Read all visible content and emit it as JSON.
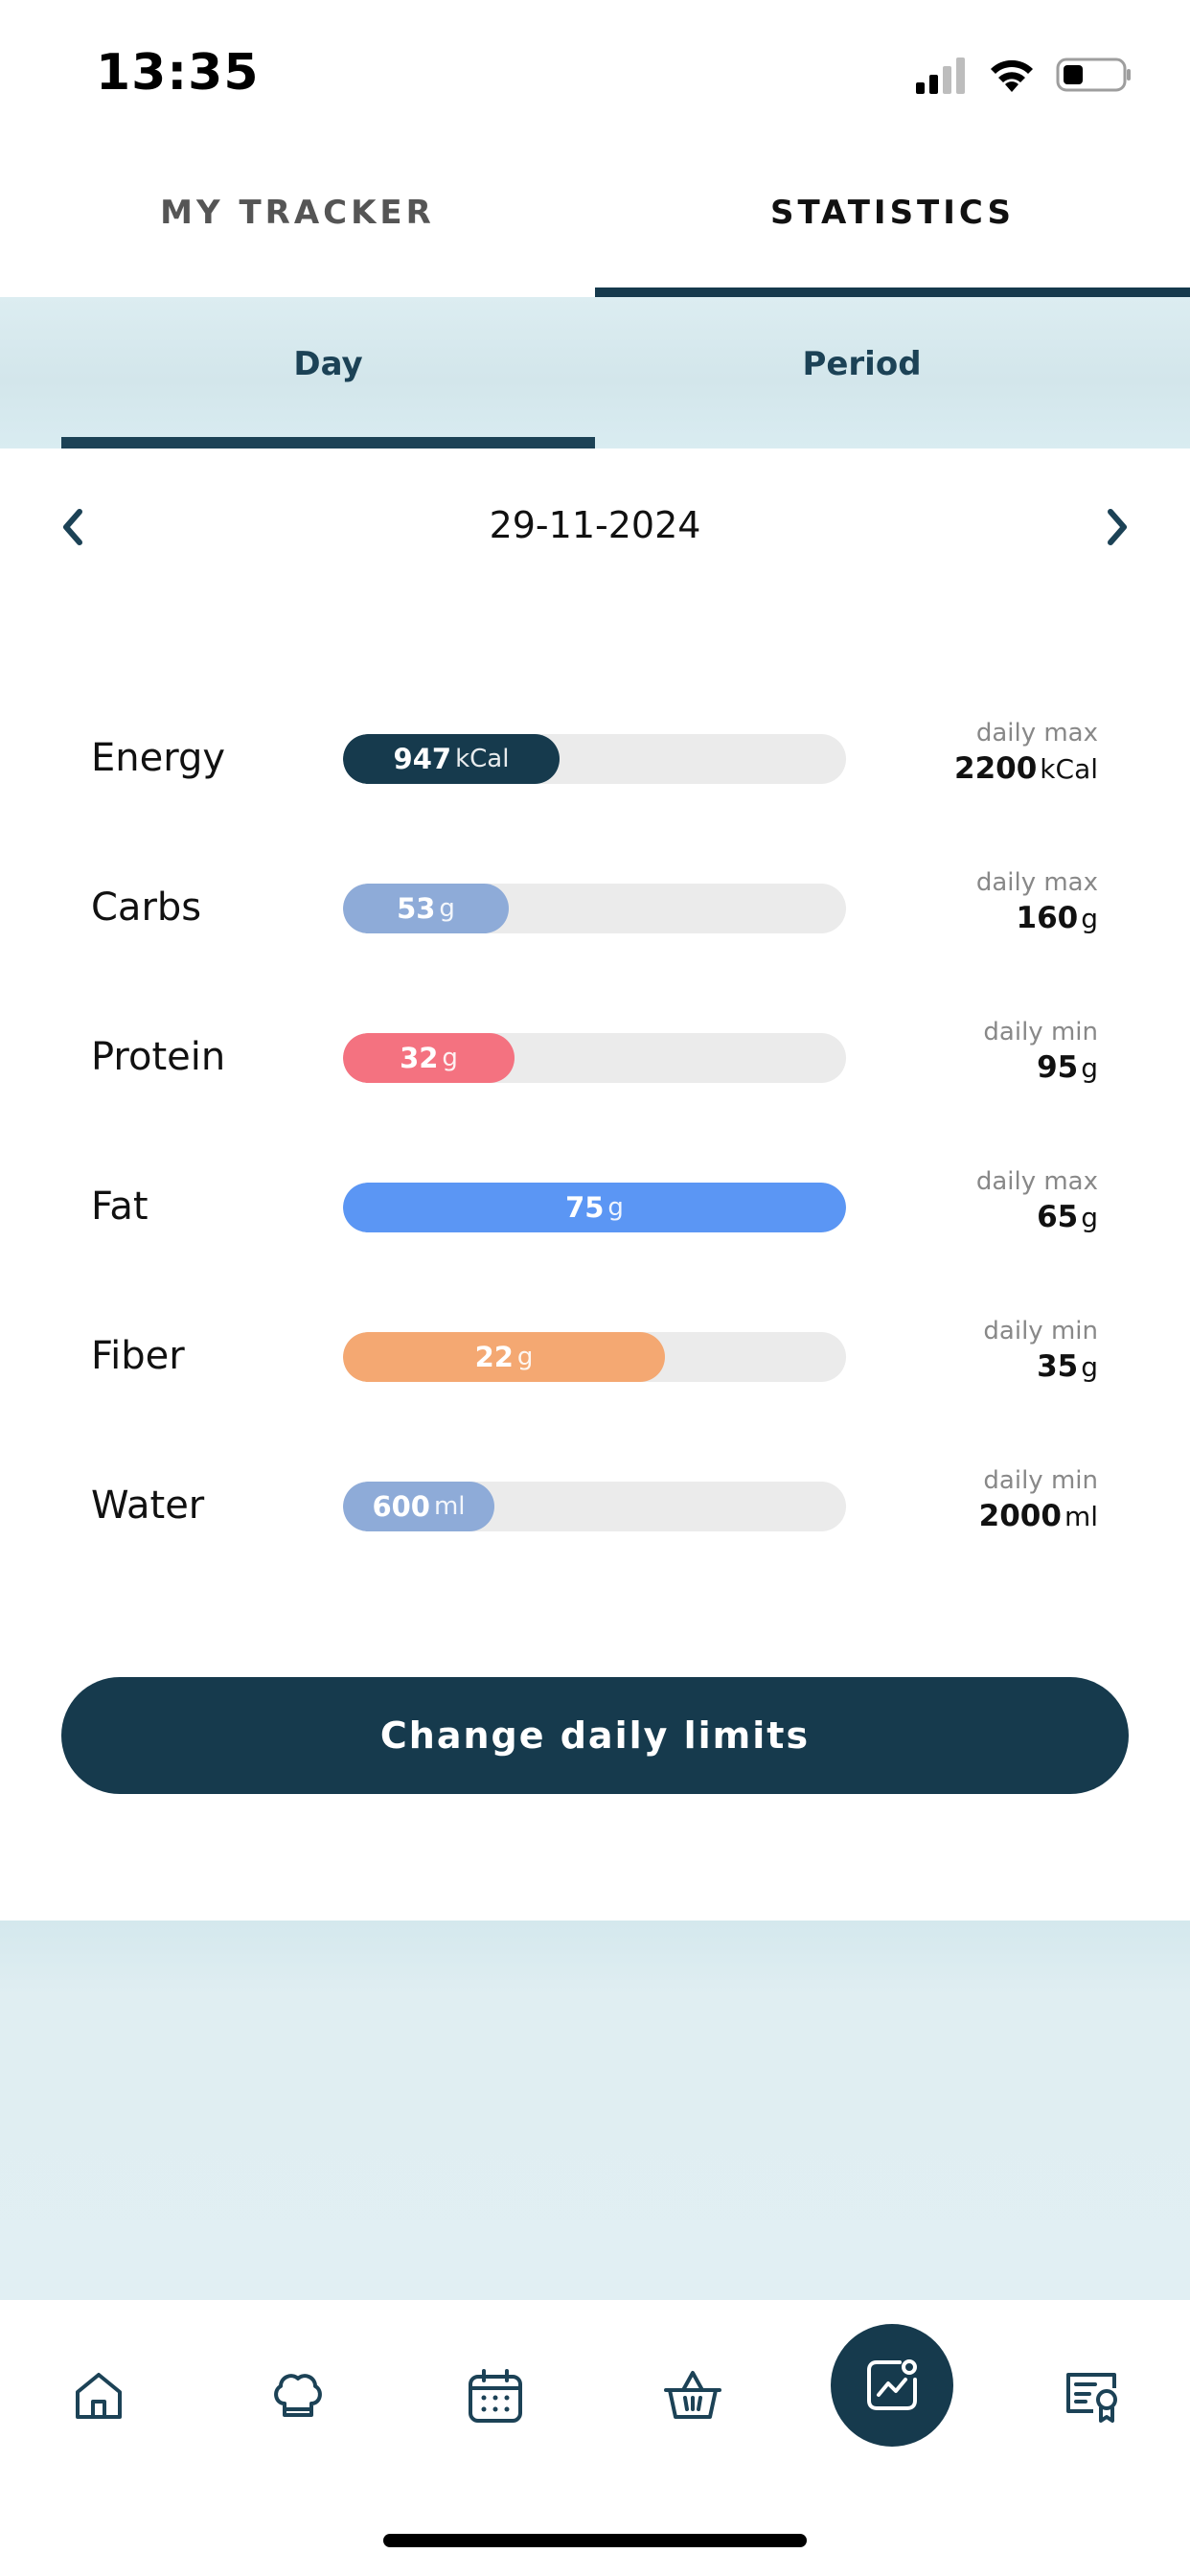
{
  "status_bar": {
    "time": "13:35"
  },
  "top_tabs": [
    {
      "label": "MY TRACKER",
      "active": false
    },
    {
      "label": "STATISTICS",
      "active": true
    }
  ],
  "sub_tabs": [
    {
      "label": "Day",
      "active": true
    },
    {
      "label": "Period",
      "active": false
    }
  ],
  "date": "29-11-2024",
  "nutrients": [
    {
      "name": "Energy",
      "value": "947",
      "unit": "kCal",
      "limit_label": "daily max",
      "limit_value": "2200",
      "limit_unit": "kCal",
      "fill_fraction": 0.43,
      "color": "#163a4d"
    },
    {
      "name": "Carbs",
      "value": "53",
      "unit": "g",
      "limit_label": "daily max",
      "limit_value": "160",
      "limit_unit": "g",
      "fill_fraction": 0.33,
      "color": "#8eabd8"
    },
    {
      "name": "Protein",
      "value": "32",
      "unit": "g",
      "limit_label": "daily min",
      "limit_value": "95",
      "limit_unit": "g",
      "fill_fraction": 0.34,
      "color": "#f47280"
    },
    {
      "name": "Fat",
      "value": "75",
      "unit": "g",
      "limit_label": "daily max",
      "limit_value": "65",
      "limit_unit": "g",
      "fill_fraction": 1.0,
      "color": "#5b96f4"
    },
    {
      "name": "Fiber",
      "value": "22",
      "unit": "g",
      "limit_label": "daily min",
      "limit_value": "35",
      "limit_unit": "g",
      "fill_fraction": 0.64,
      "color": "#f4a872"
    },
    {
      "name": "Water",
      "value": "600",
      "unit": "ml",
      "limit_label": "daily min",
      "limit_value": "2000",
      "limit_unit": "ml",
      "fill_fraction": 0.3,
      "color": "#8eabd8"
    }
  ],
  "change_button_label": "Change daily limits",
  "bottom_nav": [
    {
      "icon": "home-icon",
      "active": false
    },
    {
      "icon": "chef-hat-icon",
      "active": false
    },
    {
      "icon": "calendar-icon",
      "active": false
    },
    {
      "icon": "basket-icon",
      "active": false
    },
    {
      "icon": "statistics-icon",
      "active": true
    },
    {
      "icon": "certificate-icon",
      "active": false
    }
  ],
  "colors": {
    "primary": "#163a4d",
    "sub_tab_bg": "#d9ecf1",
    "track": "#ebebeb"
  }
}
